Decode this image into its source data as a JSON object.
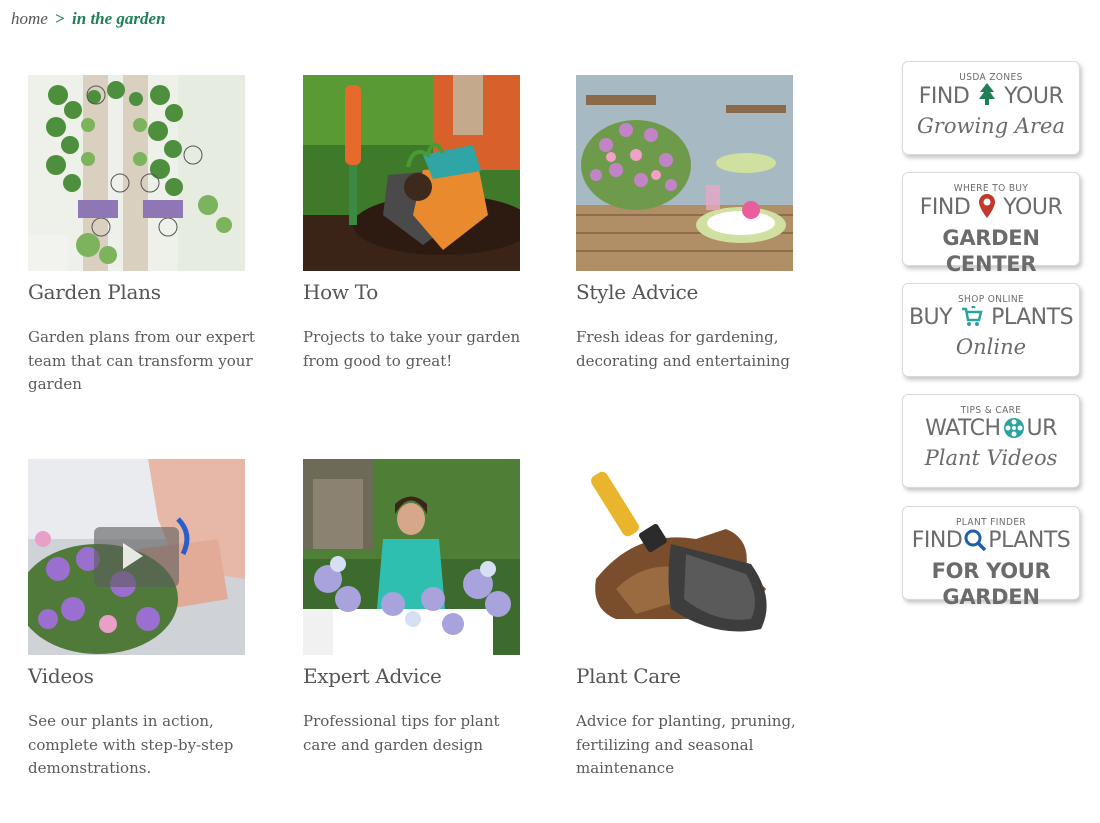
{
  "breadcrumb": {
    "home": "home",
    "separator": ">",
    "current": "in the garden"
  },
  "cards": [
    {
      "title": "Garden Plans",
      "description": "Garden plans from our expert team that can transform your garden"
    },
    {
      "title": "How To",
      "description": "Projects to take your garden from good to great!"
    },
    {
      "title": "Style Advice",
      "description": "Fresh ideas for gardening, decorating and entertaining"
    },
    {
      "title": "Videos",
      "description": "See our plants in action, complete with step-by-step demonstrations."
    },
    {
      "title": "Expert Advice",
      "description": "Professional tips for plant care and garden design"
    },
    {
      "title": "Plant Care",
      "description": "Advice for planting, pruning, fertilizing and seasonal maintenance"
    }
  ],
  "promos": {
    "zones": {
      "small": "USDA ZONES",
      "line1a": "FIND",
      "line1b": "YOUR",
      "line2": "Growing Area",
      "icon": "tree-icon"
    },
    "center": {
      "small": "WHERE TO BUY",
      "line1a": "FIND",
      "line1b": "YOUR",
      "line2": "GARDEN CENTER",
      "icon": "map-pin-icon"
    },
    "shop": {
      "small": "SHOP ONLINE",
      "line1a": "BUY",
      "line1b": "PLANTS",
      "line2": "Online",
      "icon": "cart-icon"
    },
    "videos": {
      "small": "TIPS & CARE",
      "line1a": "WATCH",
      "line1b": "UR",
      "line2": "Plant Videos",
      "icon": "film-reel-icon"
    },
    "finder": {
      "small": "PLANT FINDER",
      "line1a": "FIND",
      "line1b": "PLANTS",
      "line2": "FOR YOUR GARDEN",
      "icon": "magnifier-icon"
    }
  },
  "colors": {
    "brand_green": "#1f7f55",
    "text_gray": "#555555",
    "pin_red": "#c0392b",
    "accent_teal": "#2aa3a0",
    "finder_blue": "#1f5fa8"
  }
}
